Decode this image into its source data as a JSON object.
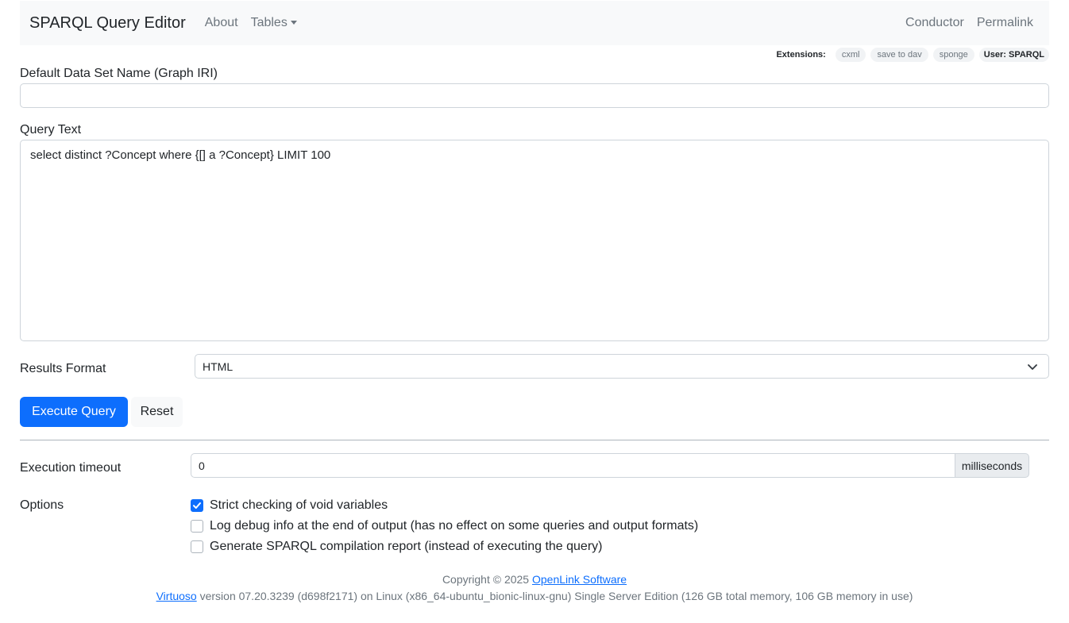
{
  "navbar": {
    "brand": "SPARQL Query Editor",
    "links": [
      "About",
      "Tables"
    ],
    "right_links": [
      "Conductor",
      "Permalink"
    ]
  },
  "extensions": {
    "label": "Extensions:",
    "items": [
      "cxml",
      "save to dav",
      "sponge"
    ],
    "user": "User: SPARQL"
  },
  "form": {
    "dataset_label": "Default Data Set Name (Graph IRI)",
    "dataset_value": "",
    "query_label": "Query Text",
    "query_value": "select distinct ?Concept where {[] a ?Concept} LIMIT 100",
    "results_format_label": "Results Format",
    "results_format_value": "HTML",
    "execute_label": "Execute Query",
    "reset_label": "Reset",
    "timeout_label": "Execution timeout",
    "timeout_value": "0",
    "timeout_unit": "milliseconds",
    "options_label": "Options",
    "options": [
      {
        "label": "Strict checking of void variables",
        "checked": true
      },
      {
        "label": "Log debug info at the end of output (has no effect on some queries and output formats)",
        "checked": false
      },
      {
        "label": "Generate SPARQL compilation report (instead of executing the query)",
        "checked": false
      }
    ]
  },
  "footer": {
    "copyright_prefix": "Copyright © 2025",
    "copyright_link": "OpenLink Software",
    "version_link": "Virtuoso",
    "version_text": "version 07.20.3239 (d698f2171) on Linux (x86_64-ubuntu_bionic-linux-gnu) Single Server Edition (126 GB total memory, 106 GB memory in use)"
  },
  "colors": {
    "primary": "#0d6efd",
    "navbar_bg": "#f8f9fa"
  }
}
